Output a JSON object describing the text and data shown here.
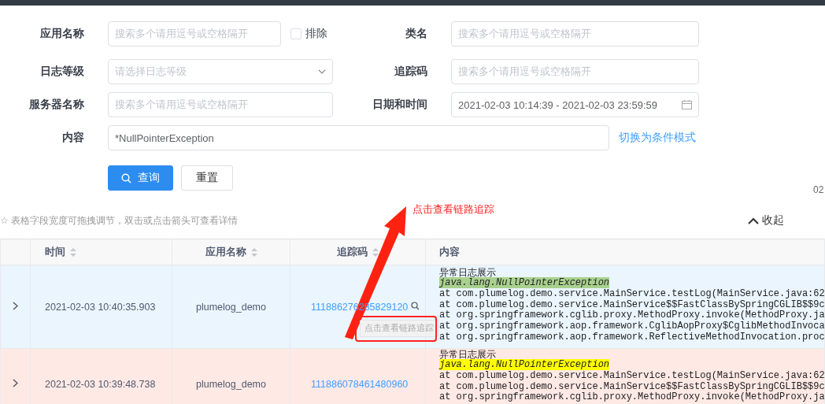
{
  "form": {
    "app_name": {
      "label": "应用名称",
      "placeholder": "搜索多个请用逗号或空格隔开"
    },
    "exclude": {
      "label": "排除",
      "checked": false
    },
    "class_name": {
      "label": "类名",
      "placeholder": "搜索多个请用逗号或空格隔开"
    },
    "log_level": {
      "label": "日志等级",
      "placeholder": "请选择日志等级"
    },
    "trace_id": {
      "label": "追踪码",
      "placeholder": "搜索多个请用逗号或空格隔开"
    },
    "server_name": {
      "label": "服务器名称",
      "placeholder": "搜索多个请用逗号或空格隔开"
    },
    "datetime": {
      "label": "日期和时间",
      "value": "2021-02-03 10:14:39 - 2021-02-03 23:59:59"
    },
    "content": {
      "label": "内容",
      "value": "*NullPointerException"
    },
    "mode_link": "切换为条件模式"
  },
  "buttons": [
    {
      "label": "查询",
      "kind": "primary"
    },
    {
      "label": "重置",
      "kind": "default"
    }
  ],
  "edge_text": "02",
  "hint": "☆ 表格字段宽度可拖拽调节，双击或点击箭头可查看详情",
  "collapse": "收起",
  "table": {
    "columns": [
      {
        "label": "时间",
        "sortable": true
      },
      {
        "label": "应用名称",
        "sortable": true
      },
      {
        "label": "追踪码",
        "sortable": true
      },
      {
        "label": "内容",
        "sortable": false
      }
    ],
    "rows": [
      {
        "selected": true,
        "time": "2021-02-03 10:40:35.903",
        "app": "plumelog_demo",
        "trace_id": "111886276285829120",
        "title": "异常日志展示",
        "exception": "java.lang.NullPointerException",
        "stack": [
          "at com.plumelog.demo.service.MainService.testLog(MainService.java:62",
          "at com.plumelog.demo.service.MainService$$FastClassBySpringCGLIB$$9c",
          "at org.springframework.cglib.proxy.MethodProxy.invoke(MethodProxy.ja",
          "at org.springframework.aop.framework.CglibAopProxy$CglibMethodInvoca",
          "at org.springframework.aop.framework.ReflectiveMethodInvocation.proc"
        ]
      },
      {
        "selected": false,
        "time": "2021-02-03 10:39:48.738",
        "app": "plumelog_demo",
        "trace_id": "111886078461480960",
        "title": "异常日志展示",
        "exception": "java.lang.NullPointerException",
        "stack": [
          "at com.plumelog.demo.service.MainService.testLog(MainService.java:62",
          "at com.plumelog.demo.service.MainService$$FastClassBySpringCGLIB$$9c",
          "at org.springframework.cglib.proxy.MethodProxy.invoke(MethodProxy.ja"
        ]
      }
    ]
  },
  "tooltip": "点击查看链路追踪",
  "annotation": "点击查看链路追踪"
}
